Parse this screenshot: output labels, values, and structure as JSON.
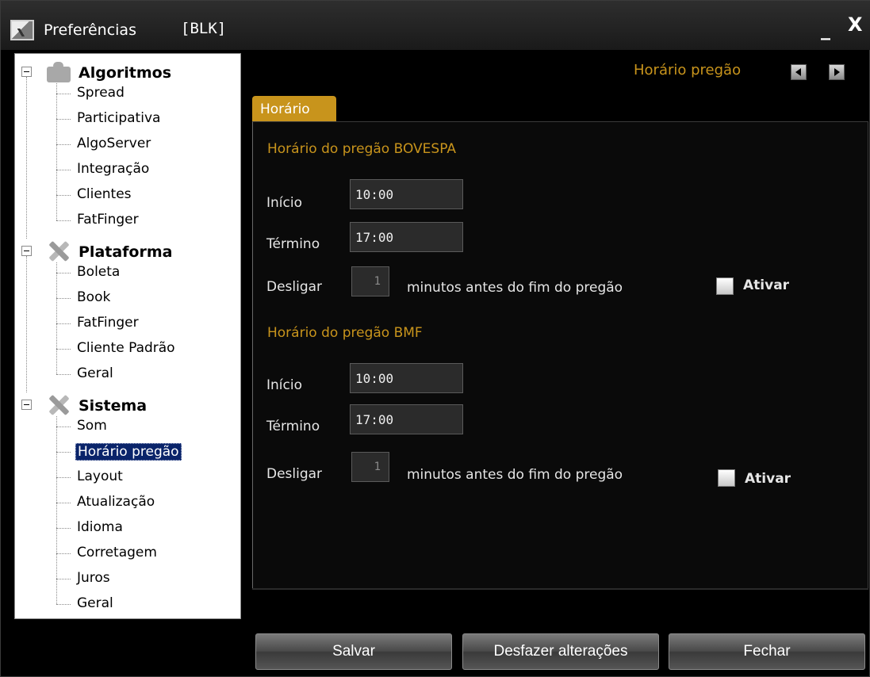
{
  "window": {
    "title": "Preferências",
    "tag": "[BLK]",
    "minimize_glyph": "_",
    "close_glyph": "X"
  },
  "tree": {
    "groups": [
      {
        "label": "Algoritmos",
        "icon": "puzzle-icon",
        "items": [
          "Spread",
          "Participativa",
          "AlgoServer",
          "Integração",
          "Clientes",
          "FatFinger"
        ]
      },
      {
        "label": "Plataforma",
        "icon": "tools-icon",
        "items": [
          "Boleta",
          "Book",
          "FatFinger",
          "Cliente Padrão",
          "Geral"
        ]
      },
      {
        "label": "Sistema",
        "icon": "tools-icon",
        "items": [
          "Som",
          "Horário pregão",
          "Layout",
          "Atualização",
          "Idioma",
          "Corretagem",
          "Juros",
          "Geral"
        ]
      }
    ],
    "selected": "Horário pregão"
  },
  "panel": {
    "nav_title": "Horário pregão",
    "tab": "Horário",
    "bovespa": {
      "title": "Horário do pregão BOVESPA",
      "start_label": "Início",
      "start_value": "10:00",
      "end_label": "Término",
      "end_value": "17:00",
      "shutdown_label": "Desligar",
      "shutdown_value": "1",
      "shutdown_suffix": "minutos antes do fim do pregão",
      "activate_label": "Ativar"
    },
    "bmf": {
      "title": "Horário do pregão BMF",
      "start_label": "Início",
      "start_value": "10:00",
      "end_label": "Término",
      "end_value": "17:00",
      "shutdown_label": "Desligar",
      "shutdown_value": "1",
      "shutdown_suffix": "minutos antes do fim do pregão",
      "activate_label": "Ativar"
    }
  },
  "buttons": {
    "save": "Salvar",
    "undo": "Desfazer alterações",
    "close": "Fechar"
  },
  "colors": {
    "accent": "#c8941c",
    "selection": "#0a246a",
    "background": "#000000"
  }
}
